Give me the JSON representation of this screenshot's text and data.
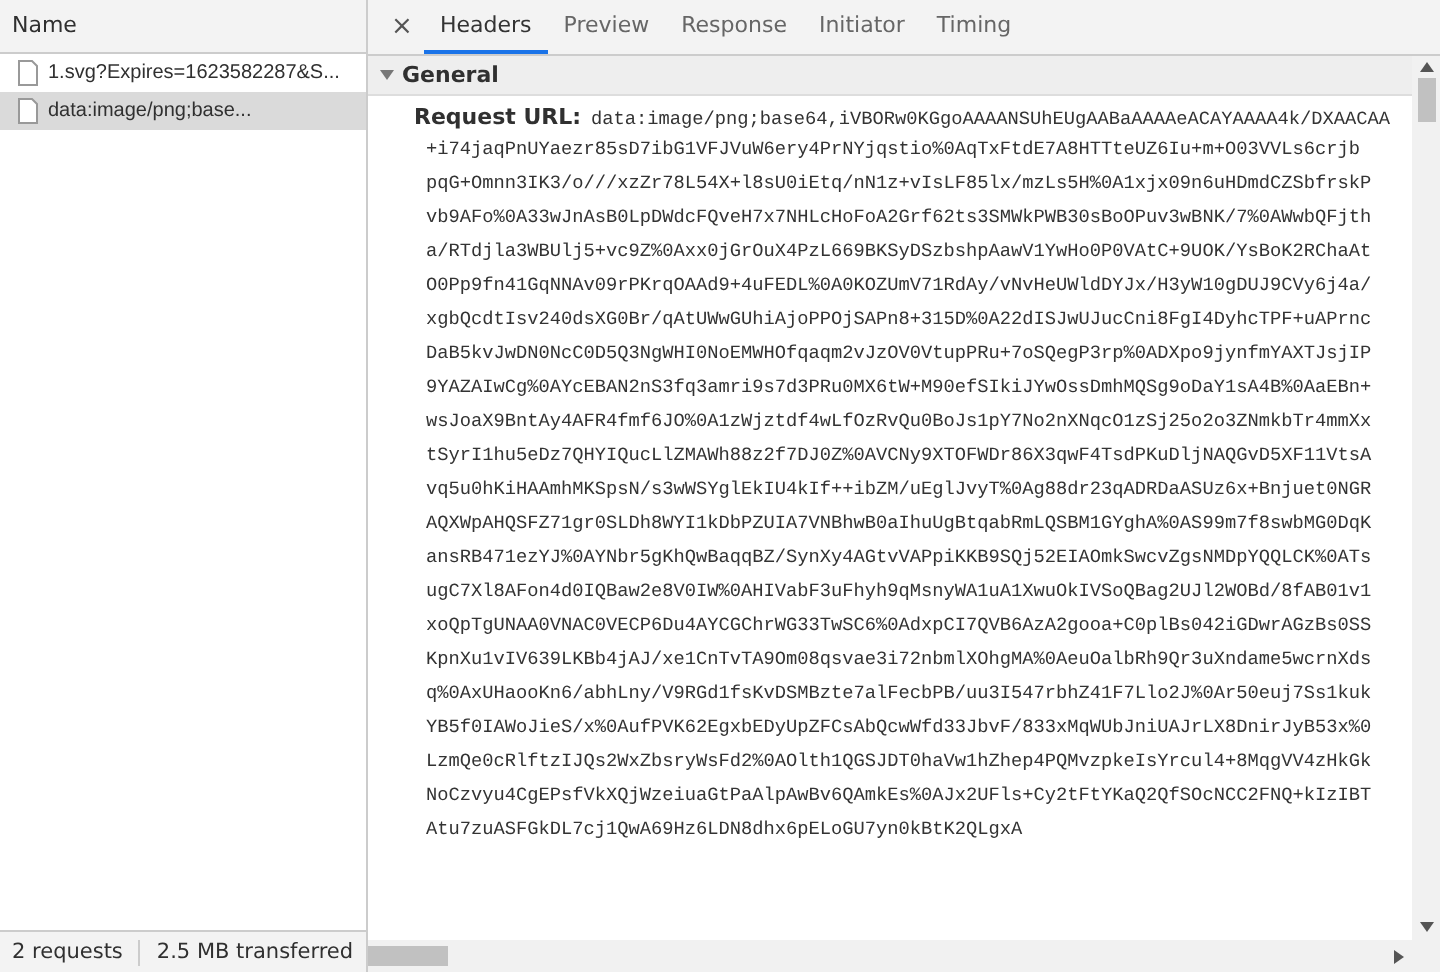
{
  "list_header": "Name",
  "requests": [
    {
      "name": "1.svg?Expires=1623582287&S...",
      "selected": false
    },
    {
      "name": "data:image/png;base...",
      "selected": true
    }
  ],
  "status_bar": {
    "requests": "2 requests",
    "transferred": "2.5 MB transferred"
  },
  "close_label": "×",
  "tabs": [
    {
      "label": "Headers",
      "selected": true
    },
    {
      "label": "Preview",
      "selected": false
    },
    {
      "label": "Response",
      "selected": false
    },
    {
      "label": "Initiator",
      "selected": false
    },
    {
      "label": "Timing",
      "selected": false
    }
  ],
  "section": {
    "title": "General",
    "expanded": true
  },
  "request_url": {
    "label": "Request URL:",
    "lines": [
      "data:image/png;base64,iVBORw0KGgoAAAANSUhEUgAABaAAAAeACAYAAAA4k/DXAACAA",
      "+i74jaqPnUYaezr85sD7ibG1VFJVuW6ery4PrNYjqstio%0AqTxFtdE7A8HTTteUZ6Iu+m+O03VVLs6crjb",
      "pqG+Omnn3IK3/o///xzZr78L54X+l8sU0iEtq/nN1z+vIsLF85lx/mzLs5H%0A1xjx09n6uHDmdCZSbfrskP",
      "vb9AFo%0A33wJnAsB0LpDWdcFQveH7x7NHLcHoFoA2Grf62ts3SMWkPWB30sBoOPuv3wBNK/7%0AWwbQFjth",
      "a/RTdjla3WBUlj5+vc9Z%0Axx0jGrOuX4PzL669BKSyDSzbshpAawV1YwHo0P0VAtC+9UOK/YsBoK2RChaAt",
      "O0Pp9fn41GqNNAv09rPKrqOAAd9+4uFEDL%0A0KOZUmV71RdAy/vNvHeUWldDYJx/H3yW10gDUJ9CVy6j4a/",
      "xgbQcdtIsv240dsXG0Br/qAtUWwGUhiAjoPPOjSAPn8+315D%0A22dISJwUJucCni8FgI4DyhcTPF+uAPrnc",
      "DaB5kvJwDN0NcC0D5Q3NgWHI0NoEMWHOfqaqm2vJzOV0VtupPRu+7oSQegP3rp%0ADXpo9jynfmYAXTJsjIP",
      "9YAZAIwCg%0AYcEBAN2nS3fq3amri9s7d3PRu0MX6tW+M90efSIkiJYwOssDmhMQSg9oDaY1sA4B%0AaEBn+",
      "wsJoaX9BntAy4AFR4fmf6JO%0A1zWjztdf4wLfOzRvQu0BoJs1pY7No2nXNqcO1zSj25o2o3ZNmkbTr4mmXx",
      "tSyrI1hu5eDz7QHYIQucLlZMAWh88z2f7DJ0Z%0AVCNy9XTOFWDr86X3qwF4TsdPKuDljNAQGvD5XF11VtsA",
      "vq5u0hKiHAAmhMKSpsN/s3wWSYglEkIU4kIf++ibZM/uEglJvyT%0Ag88dr23qADRDaASUz6x+Bnjuet0NGR",
      "AQXWpAHQSFZ71gr0SLDh8WYI1kDbPZUIA7VNBhwB0aIhuUgBtqabRmLQSBM1GYghA%0AS99m7f8swbMG0DqK",
      "ansRB471ezYJ%0AYNbr5gKhQwBaqqBZ/SynXy4AGtvVAPpiKKB9SQj52EIAOmkSwcvZgsNMDpYQQLCK%0ATs",
      "ugC7Xl8AFon4d0IQBaw2e8V0IW%0AHIVabF3uFhyh9qMsnyWA1uA1XwuOkIVSoQBag2UJl2WOBd/8fAB01v1",
      "xoQpTgUNAA0VNAC0VECP6Du4AYCGChrWG33TwSC6%0AdxpCI7QVB6AzA2gooa+C0plBs042iGDwrAGzBs0SS",
      "KpnXu1vIV639LKBb4jAJ/xe1CnTvTA9Om08qsvae3i72nbmlXOhgMA%0AeuOalbRh9Qr3uXndame5wcrnXds",
      "q%0AxUHaooKn6/abhLny/V9RGd1fsKvDSMBzte7alFecbPB/uu3I547rbhZ41F7Llo2J%0Ar50euj7Ss1kuk",
      "YB5f0IAWoJieS/x%0AufPVK62EgxbEDyUpZFCsAbQcwWfd33JbvF/833xMqWUbJniUAJrLX8DnirJyB53x%0",
      "LzmQe0cRlftzIJQs2WxZbsryWsFd2%0AOlth1QGSJDT0haVw1hZhep4PQMvzpkeIsYrcul4+8MqgVV4zHkGk",
      "NoCzvyu4CgEPsfVkXQjWzeiuaGtPaAlpAwBv6QAmkEs%0AJx2UFls+Cy2tFtYKaQ2QfSOcNCC2FNQ+kIzIBT",
      "Atu7zuASFGkDL7cj1QwA69Hz6LDN8dhx6pELoGU7yn0kBtK2QLgxA"
    ]
  }
}
